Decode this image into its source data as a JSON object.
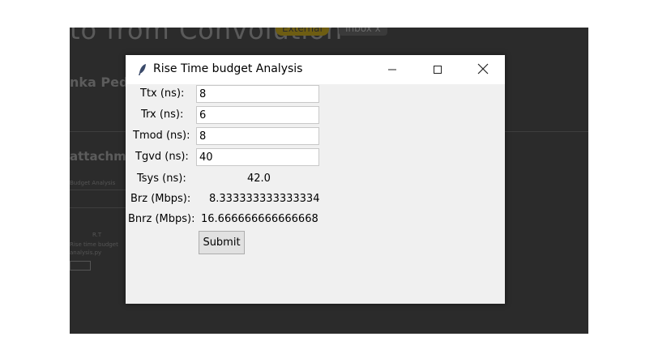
{
  "background": {
    "title": "to from Convolution",
    "badge_external": "External",
    "badge_inbox": "Inbox x",
    "name": "nka Pedd",
    "attachments": "attachme",
    "small_text_1": "Budget Analysis",
    "small_text_2": "R.T",
    "small_text_3": "Rise time budget",
    "small_text_4": "analysis.py"
  },
  "window": {
    "title": "Rise Time budget Analysis",
    "icon": "feather-icon",
    "controls": {
      "minimize": "minimize-icon",
      "maximize": "maximize-icon",
      "close": "close-icon"
    }
  },
  "form": {
    "ttx_label": "Ttx (ns):",
    "ttx_value": "8",
    "trx_label": "Trx (ns):",
    "trx_value": "6",
    "tmod_label": "Tmod (ns):",
    "tmod_value": "8",
    "tgvd_label": "Tgvd (ns):",
    "tgvd_value": "40",
    "tsys_label": "Tsys (ns):",
    "tsys_value": "42.0",
    "brz_label": "Brz (Mbps):",
    "brz_value": "8.333333333333334",
    "bnrz_label": "Bnrz (Mbps):",
    "bnrz_value": "16.666666666666668",
    "submit_label": "Submit"
  }
}
